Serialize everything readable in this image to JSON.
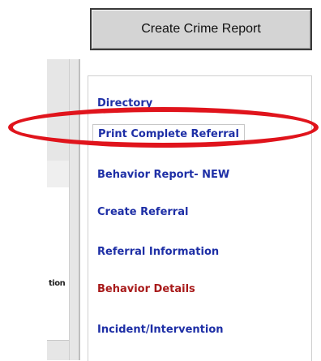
{
  "header": {
    "create_button_label": "Create Crime Report"
  },
  "left_panel": {
    "fragment_text": "tion"
  },
  "menu": {
    "items": [
      {
        "label": "Directory"
      },
      {
        "label": "Print Complete Referral"
      },
      {
        "label": "Behavior Report- NEW"
      },
      {
        "label": "Create Referral"
      },
      {
        "label": "Referral Information"
      },
      {
        "label": "Behavior Details"
      },
      {
        "label": "Incident/Intervention"
      }
    ]
  },
  "colors": {
    "link_blue": "#1e2fa6",
    "link_red": "#a81a1a",
    "highlight_red": "#e0141c",
    "button_gray": "#d4d4d4"
  }
}
